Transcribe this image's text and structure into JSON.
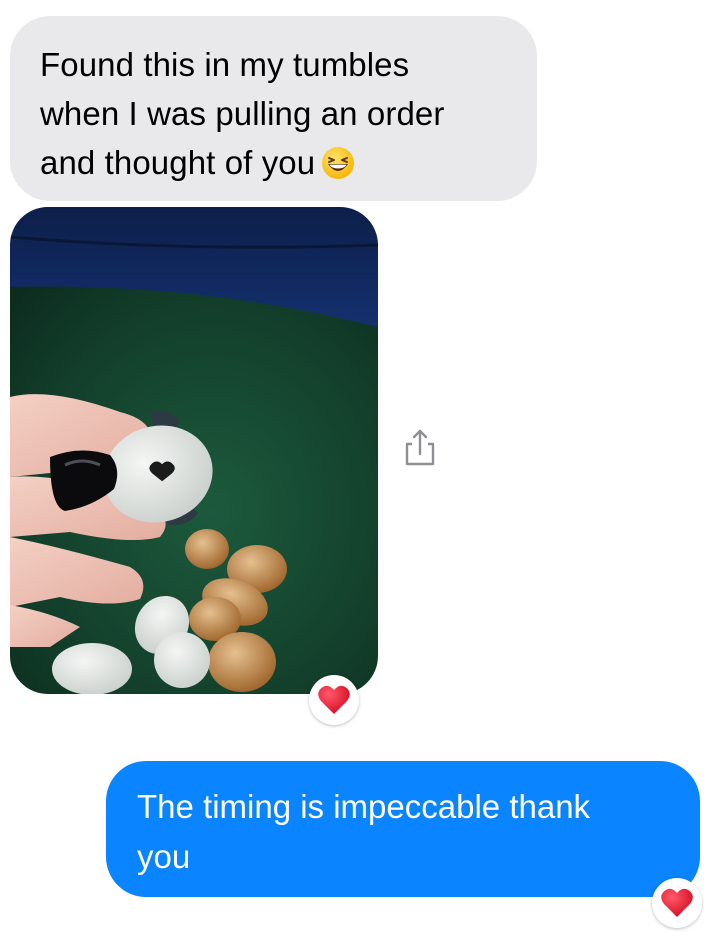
{
  "conversation": {
    "incoming_message": {
      "lines": [
        "Found this in my tumbles",
        "when I was pulling an order",
        "and thought of you"
      ],
      "emoji": "grinning-squinting-face-emoji"
    },
    "photo": {
      "description_icon": "photo-attachment"
    },
    "share_icon": "share-icon",
    "outgoing_message": {
      "lines": [
        "The timing is impeccable thank",
        "you"
      ]
    },
    "reactions": [
      "heart-reaction-icon",
      "heart-reaction-icon"
    ]
  },
  "colors": {
    "incoming_bubble": "#e9e9eb",
    "outgoing_bubble": "#0a84ff",
    "heart": "#e8102a"
  }
}
